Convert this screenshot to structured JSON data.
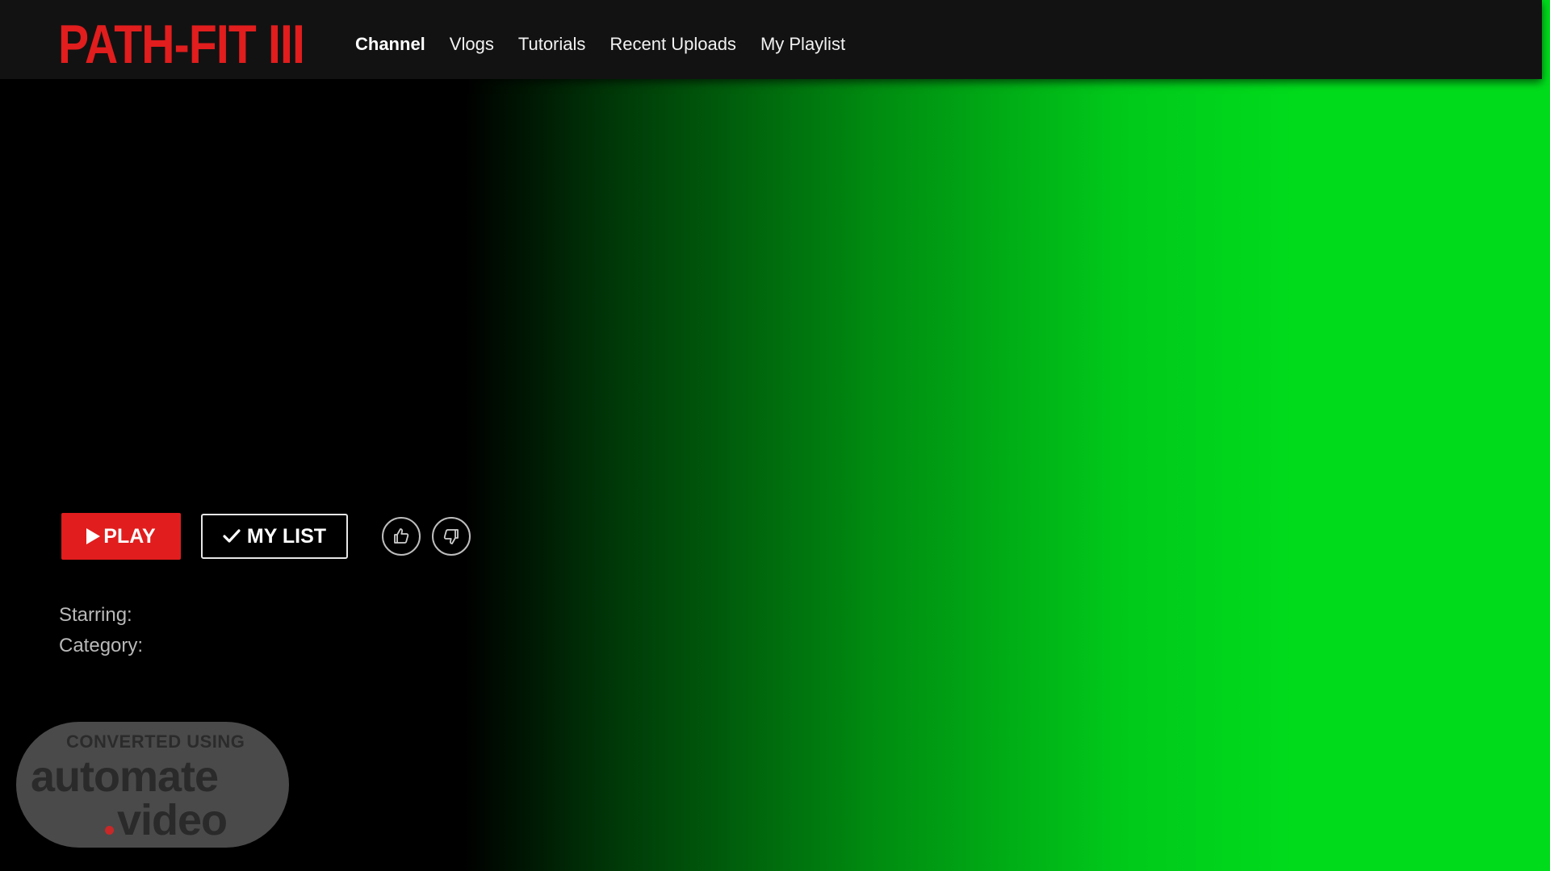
{
  "brand": {
    "logo_text": "PATH-FIT III",
    "logo_color": "#e11d1d"
  },
  "nav": {
    "items": [
      {
        "label": "Channel",
        "active": true
      },
      {
        "label": "Vlogs"
      },
      {
        "label": "Tutorials"
      },
      {
        "label": "Recent Uploads"
      },
      {
        "label": "My Playlist"
      }
    ]
  },
  "actions": {
    "play_label": "PLAY",
    "mylist_label": "MY LIST",
    "like_icon": "thumbs-up-icon",
    "dislike_icon": "thumbs-down-icon"
  },
  "meta": {
    "starring_label": "Starring:",
    "category_label": "Category:"
  },
  "watermark": {
    "top_text": "CONVERTED USING",
    "main_text": "automate",
    "sub_text": "video"
  },
  "colors": {
    "accent": "#e11d1d",
    "hero_green": "#00dc1c",
    "topbar": "#121212"
  }
}
